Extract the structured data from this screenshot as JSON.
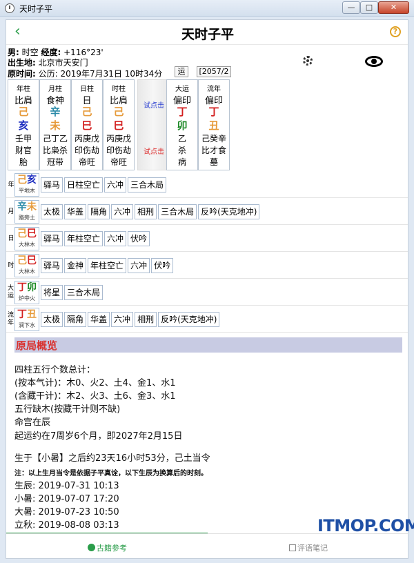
{
  "window": {
    "title": "天时子平",
    "min": "—",
    "max": "□",
    "close": "✕"
  },
  "header": {
    "back": "‹",
    "title": "天时子平",
    "help": "?"
  },
  "info": {
    "gender": "男:",
    "name": "时空",
    "lng_label": "经度:",
    "lng": "+116°23'",
    "birthplace_label": "出生地:",
    "birthplace": "北京市天安门",
    "time_label": "原时间:",
    "time": "公历: 2019年7月31日 10时34分",
    "yun_btn": "运",
    "year_btn": "[2057/2"
  },
  "pillars": [
    {
      "label": "年柱",
      "god": "比肩",
      "gan": "己",
      "gan_color": "#e69a3a",
      "zhi": "亥",
      "zhi_color": "#1f2fc0",
      "hidden": "壬甲",
      "hidden_gods": "财官",
      "state": "胎"
    },
    {
      "label": "月柱",
      "god": "食神",
      "gan": "辛",
      "gan_color": "#2a8aa8",
      "zhi": "未",
      "zhi_color": "#e69a3a",
      "hidden": "己丁乙",
      "hidden_gods": "比枭杀",
      "state": "冠带"
    },
    {
      "label": "日柱",
      "god": "日",
      "gan": "己",
      "gan_color": "#e69a3a",
      "zhi": "巳",
      "zhi_color": "#d32020",
      "hidden": "丙庚戊",
      "hidden_gods": "印伤劫",
      "state": "帝旺"
    },
    {
      "label": "时柱",
      "god": "比肩",
      "gan": "己",
      "gan_color": "#e69a3a",
      "zhi": "巳",
      "zhi_color": "#d32020",
      "hidden": "丙庚戊",
      "hidden_gods": "印伤劫",
      "state": "帝旺"
    },
    {
      "label": "大运",
      "god": "偏印",
      "gan": "丁",
      "gan_color": "#d32020",
      "zhi": "卯",
      "zhi_color": "#1e8a28",
      "hidden": "乙",
      "hidden_gods": "杀",
      "state": "病"
    },
    {
      "label": "流年",
      "god": "偏印",
      "gan": "丁",
      "gan_color": "#d32020",
      "zhi": "丑",
      "zhi_color": "#e69a3a",
      "hidden": "己癸辛",
      "hidden_gods": "比才食",
      "state": "墓"
    }
  ],
  "try_buttons": {
    "top": "试点击",
    "bottom": "试点击"
  },
  "rows": [
    {
      "label": "年",
      "gan": "己",
      "gan_color": "#e69a3a",
      "zhi": "亥",
      "zhi_color": "#1f2fc0",
      "nayin": "平地木",
      "tags": [
        "驿马",
        "日柱空亡",
        "六冲",
        "三合木局"
      ]
    },
    {
      "label": "月",
      "gan": "辛",
      "gan_color": "#2a8aa8",
      "zhi": "未",
      "zhi_color": "#e69a3a",
      "nayin": "路旁土",
      "tags": [
        "太极",
        "华盖",
        "隔角",
        "六冲",
        "相刑",
        "三合木局",
        "反吟(天克地冲)"
      ]
    },
    {
      "label": "日",
      "gan": "己",
      "gan_color": "#e69a3a",
      "zhi": "巳",
      "zhi_color": "#d32020",
      "nayin": "大林木",
      "tags": [
        "驿马",
        "年柱空亡",
        "六冲",
        "伏吟"
      ]
    },
    {
      "label": "时",
      "gan": "己",
      "gan_color": "#e69a3a",
      "zhi": "巳",
      "zhi_color": "#d32020",
      "nayin": "大林木",
      "tags": [
        "驿马",
        "金神",
        "年柱空亡",
        "六冲",
        "伏吟"
      ]
    },
    {
      "label": "大运",
      "gan": "丁",
      "gan_color": "#d32020",
      "zhi": "卯",
      "zhi_color": "#1e8a28",
      "nayin": "炉中火",
      "tags": [
        "将星",
        "三合木局"
      ]
    },
    {
      "label": "流年",
      "gan": "丁",
      "gan_color": "#d32020",
      "zhi": "丑",
      "zhi_color": "#e69a3a",
      "nayin": "涧下水",
      "tags": [
        "太极",
        "隔角",
        "华盖",
        "六冲",
        "相刑",
        "反吟(天克地冲)"
      ]
    }
  ],
  "overview": {
    "title": "原局概览",
    "l1": "四柱五行个数总计：",
    "l2": "(按本气计)：木0、火2、土4、金1、水1",
    "l3": "(含藏干计)：木2、火3、土6、金3、水1",
    "l4": "五行缺木(按藏干计则不缺)",
    "l5": "命宫在辰",
    "l6": "起运约在7周岁6个月，即2027年2月15日",
    "l7": "生于【小暑】之后约23天16小时53分，己土当令",
    "note": "注：以上生月当令是依据子平真诠，以下生辰为换算后的时刻。",
    "birth": "生辰: 2019-07-31 10:13",
    "xiaoshu": "小暑: 2019-07-07 17:20",
    "dashu": "大暑: 2019-07-23 10:50",
    "liqiu": "立秋: 2019-08-08 03:13"
  },
  "bottom": {
    "left": "古籍参考",
    "right": "评语笔记",
    "watermark": "ITMOP.COM"
  }
}
